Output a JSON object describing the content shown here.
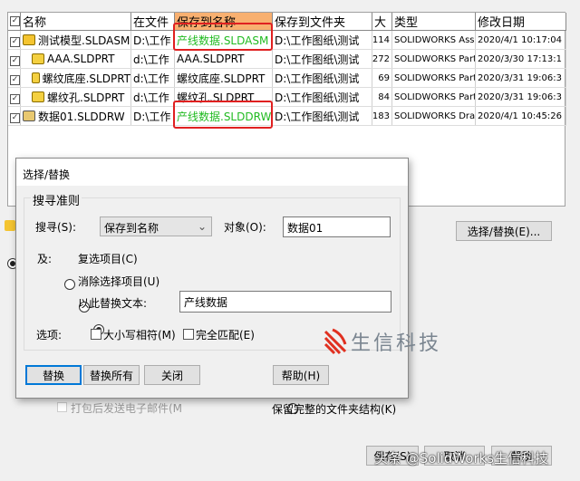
{
  "table": {
    "headers": [
      "名称",
      "在文件",
      "保存到名称",
      "保存到文件夹",
      "大",
      "类型",
      "修改日期"
    ],
    "rows": [
      {
        "name": "测试模型.SLDASM",
        "icon": "assembly",
        "in_file": "D:\\工作",
        "save_name": "产线数据.SLDASM",
        "folder": "D:\\工作图纸\\测试",
        "size": "114",
        "type": "SOLIDWORKS Ass",
        "date": "2020/4/1 10:17:04",
        "highlight": true
      },
      {
        "name": "AAA.SLDPRT",
        "icon": "part",
        "in_file": "d:\\工作",
        "save_name": "AAA.SLDPRT",
        "folder": "D:\\工作图纸\\测试",
        "size": "272",
        "type": "SOLIDWORKS Part",
        "date": "2020/3/30 17:13:1",
        "highlight": false
      },
      {
        "name": "螺纹底座.SLDPRT",
        "icon": "part",
        "in_file": "d:\\工作",
        "save_name": "螺纹底座.SLDPRT",
        "folder": "D:\\工作图纸\\测试",
        "size": "69",
        "type": "SOLIDWORKS Part",
        "date": "2020/3/31 19:06:3",
        "highlight": false
      },
      {
        "name": "螺纹孔.SLDPRT",
        "icon": "part",
        "in_file": "d:\\工作",
        "save_name": "螺纹孔.SLDPRT",
        "folder": "D:\\工作图纸\\测试",
        "size": "84",
        "type": "SOLIDWORKS Part",
        "date": "2020/3/31 19:06:3",
        "highlight": false
      },
      {
        "name": "数据01.SLDDRW",
        "icon": "drawing",
        "in_file": "D:\\工作",
        "save_name": "产线数据.SLDDRW",
        "folder": "D:\\工作图纸\\测试",
        "size": "183",
        "type": "SOLIDWORKS Dra",
        "date": "2020/4/1 10:45:26",
        "highlight": true
      }
    ]
  },
  "background": {
    "select_replace_button": "选择/替换(E)...",
    "email_checkbox": "打包后发送电子邮件(M",
    "keep_folder_radio": "保留完整的文件夹结构(K)",
    "save_button": "保存(S)",
    "cancel_button": "取消",
    "help_button": "帮助"
  },
  "dialog": {
    "title": "选择/替换",
    "group_title": "搜寻准则",
    "search_label": "搜寻(S):",
    "search_value": "保存到名称",
    "object_label": "对象(O):",
    "object_value": "数据01",
    "and_label": "及:",
    "opt_check": "复选项目(C)",
    "opt_uncheck": "消除选择项目(U)",
    "opt_replace": "以此替换文本:",
    "replace_value": "产线数据",
    "options_label": "选项:",
    "match_case": "大小写相符(M)",
    "whole_word": "完全匹配(E)",
    "btn_replace": "替换",
    "btn_replace_all": "替换所有",
    "btn_close": "关闭",
    "btn_help": "帮助(H)"
  },
  "logo_text": "生信科技",
  "watermark": "头条 @SolidWorks生信科技",
  "colors": {
    "highlight_box": "#e02020",
    "new_name": "#22bb22",
    "logo_red": "#e03020"
  }
}
